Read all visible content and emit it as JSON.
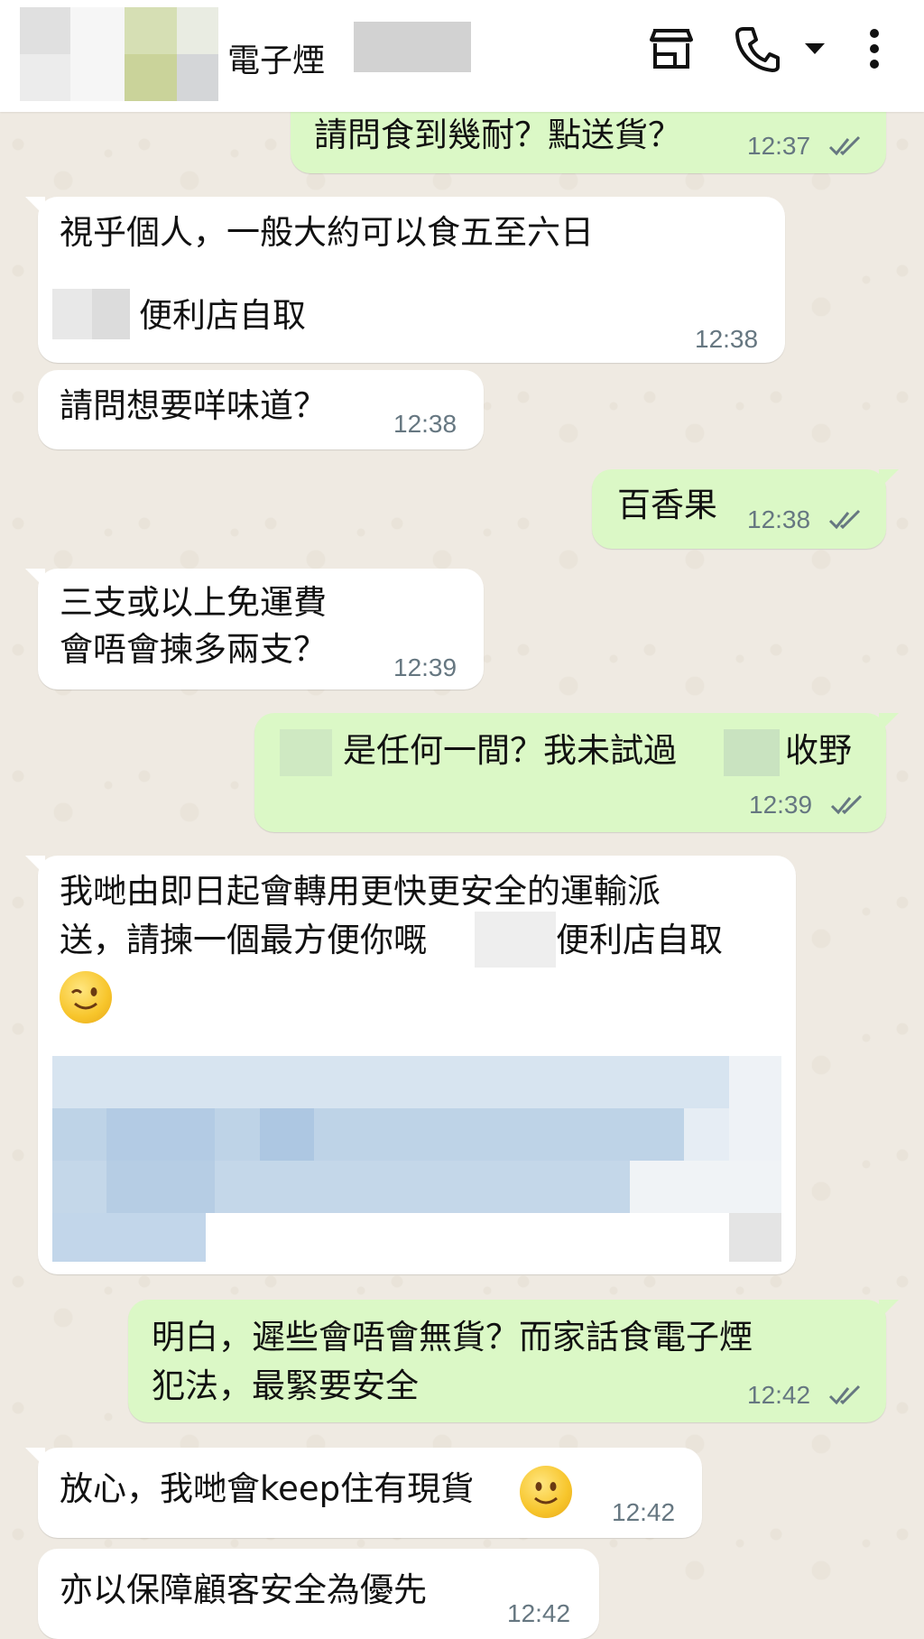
{
  "header": {
    "title": "電子煙",
    "icons": [
      "store-icon",
      "phone-icon",
      "chevron-down-icon",
      "more-vert-icon"
    ]
  },
  "messages": [
    {
      "dir": "out",
      "text": "請問食到幾耐？點送貨？",
      "time": "12:37",
      "status": "read"
    },
    {
      "dir": "in",
      "line1": "視乎個人，一般大約可以食五至六日",
      "line2": "便利店自取",
      "time": "12:38"
    },
    {
      "dir": "in",
      "text": "請問想要咩味道？",
      "time": "12:38"
    },
    {
      "dir": "out",
      "text": "百香果",
      "time": "12:38",
      "status": "read"
    },
    {
      "dir": "in",
      "line1": "三支或以上免運費",
      "line2": "會唔會揀多兩支？",
      "time": "12:39"
    },
    {
      "dir": "out",
      "part1": "是任何一間？我未試過",
      "part2": "收野",
      "time": "12:39",
      "status": "read"
    },
    {
      "dir": "in",
      "line1": "我哋由即日起會轉用更快更安全的運輸派",
      "line2a": "送，請揀一個最方便你嘅",
      "line2b": "便利店自取",
      "emoji": "wink-face",
      "time": ""
    },
    {
      "dir": "out",
      "line1": "明白，遲些會唔會無貨？而家話食電子煙",
      "line2": "犯法，最緊要安全",
      "time": "12:42",
      "status": "read"
    },
    {
      "dir": "in",
      "text": "放心，我哋會keep住有現貨",
      "emoji": "smile-face",
      "time": "12:42"
    },
    {
      "dir": "in",
      "text": "亦以保障顧客安全為優先",
      "time": "12:42"
    }
  ],
  "colors": {
    "chat_bg": "#efeae2",
    "outgoing_bubble": "#dbf8c6",
    "incoming_bubble": "#ffffff",
    "timestamp": "#667781"
  }
}
